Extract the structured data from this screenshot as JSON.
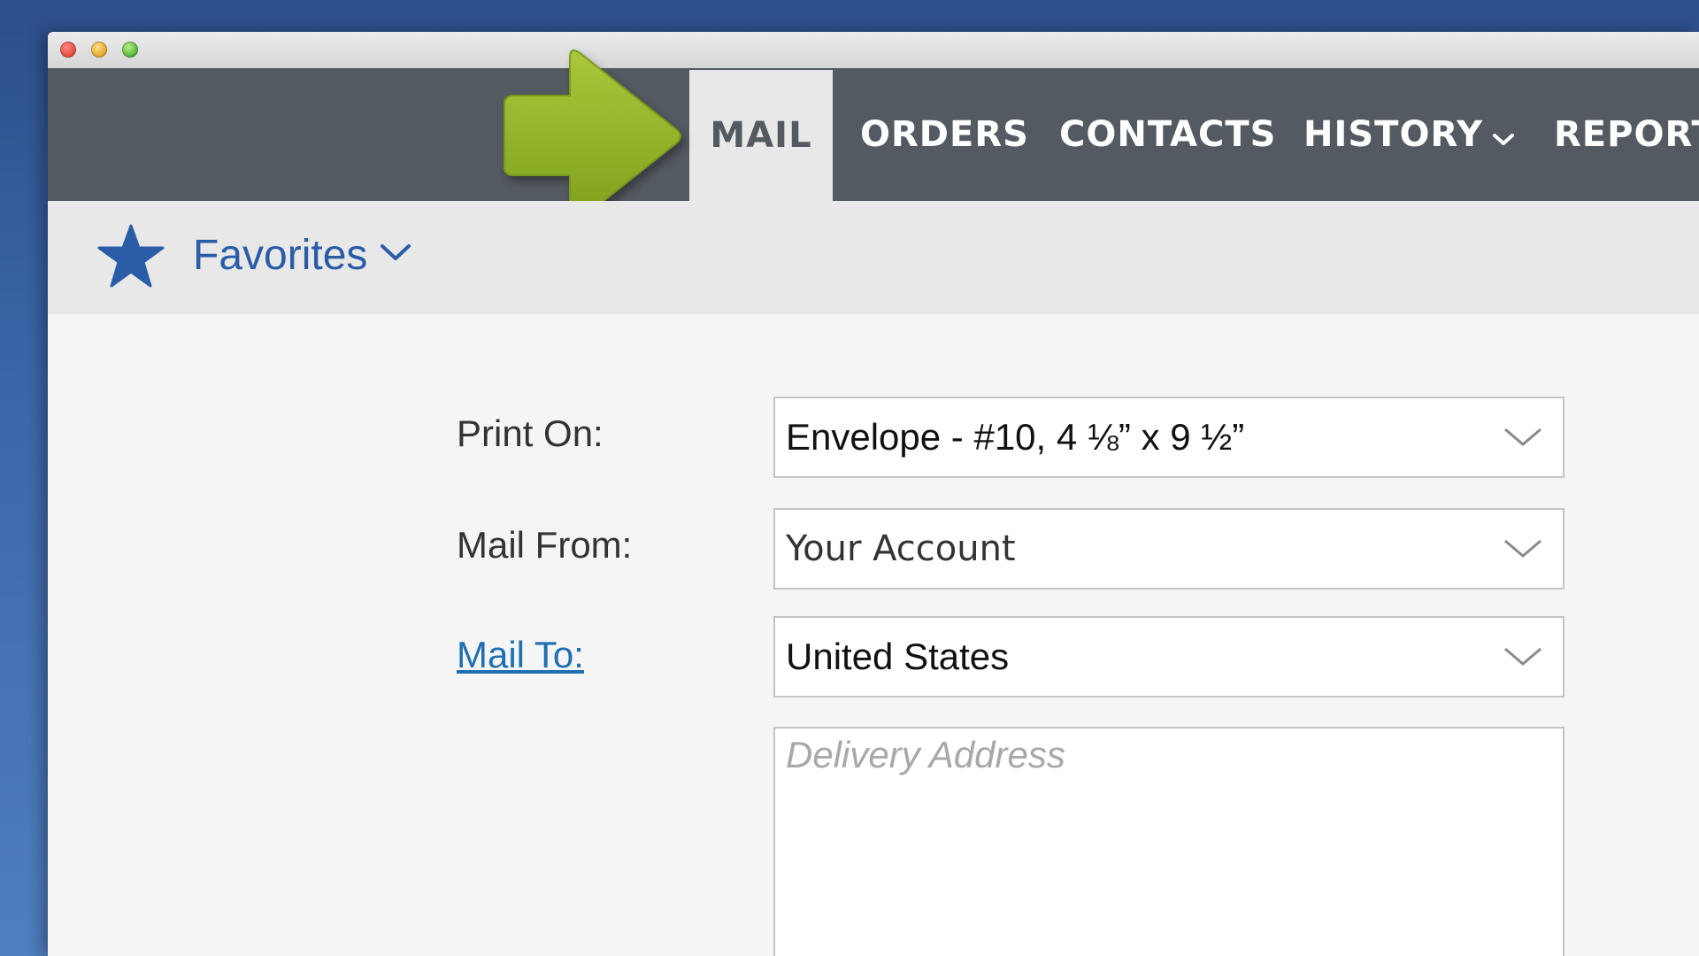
{
  "window": {
    "traffic_lights": [
      "close",
      "minimize",
      "maximize"
    ]
  },
  "nav": {
    "tabs": [
      {
        "label": "MAIL",
        "active": true
      },
      {
        "label": "ORDERS",
        "active": false
      },
      {
        "label": "CONTACTS",
        "active": false
      },
      {
        "label": "HISTORY",
        "active": false,
        "has_dropdown": true
      },
      {
        "label": "REPORT",
        "active": false
      }
    ],
    "background_color": "#545a61",
    "active_tab_color": "#e8e8e8"
  },
  "callout_arrow": {
    "color": "#8db024",
    "icon": "arrow-right-icon"
  },
  "favorites": {
    "label": "Favorites",
    "icon": "star-icon",
    "accent_color": "#2a5ca8"
  },
  "form": {
    "print_on": {
      "label": "Print On:",
      "value": "Envelope - #10, 4 ⅛” x 9 ½”"
    },
    "mail_from": {
      "label": "Mail From:",
      "value": "Your Account"
    },
    "mail_to": {
      "label": "Mail To:",
      "value": "United States"
    },
    "delivery_address": {
      "placeholder": "Delivery Address",
      "value": ""
    }
  }
}
